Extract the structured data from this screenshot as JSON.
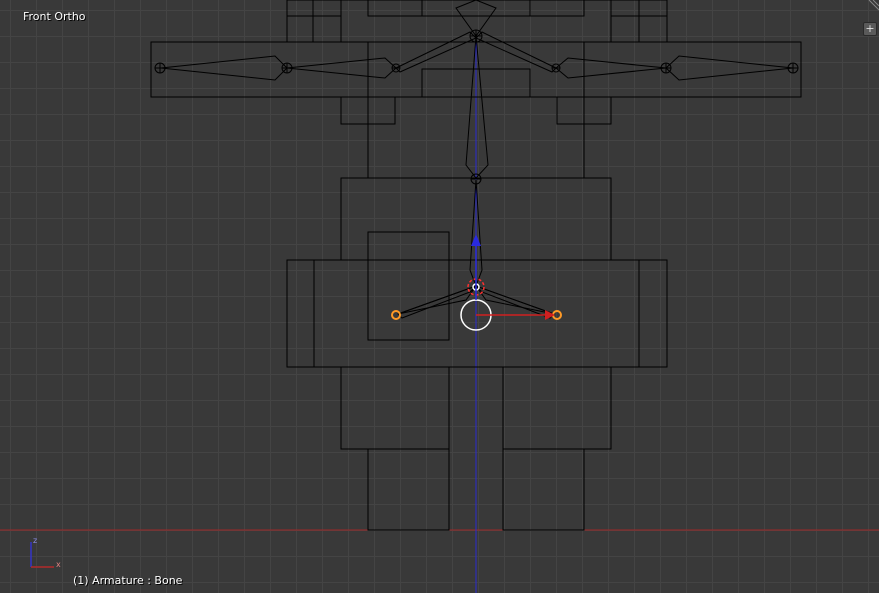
{
  "viewport": {
    "view_name": "Front Ortho",
    "status": "(1) Armature : Bone",
    "toolshelf_toggle": "+"
  },
  "axes_widget": {
    "x_label": "x",
    "z_label": "z"
  },
  "colors": {
    "background": "#393939",
    "grid": "#444444",
    "wire": "#000000",
    "x_axis": "#b22a2a",
    "z_axis": "#3434c8",
    "selected_bone": "#ff9a26",
    "cursor": "#ffffff"
  }
}
